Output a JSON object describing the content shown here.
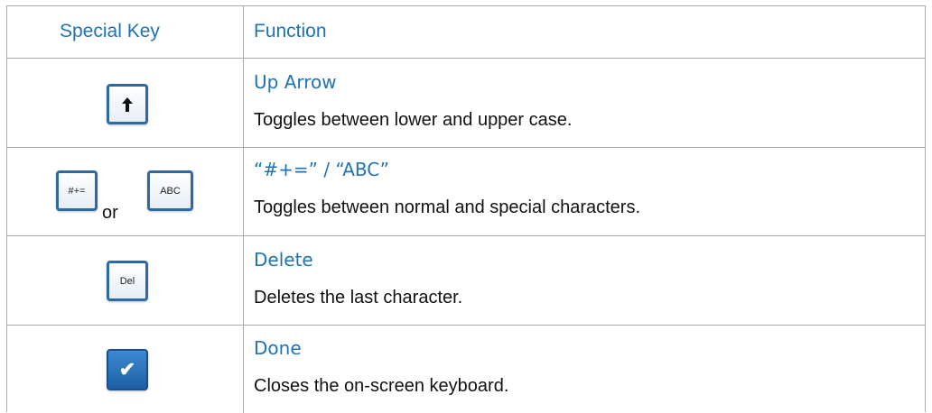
{
  "header": {
    "special_key": "Special Key",
    "function": "Function"
  },
  "rows": [
    {
      "key_icon": "up-arrow-icon",
      "title": "Up Arrow",
      "description": "Toggles between lower and upper case."
    },
    {
      "key_labels": [
        "#+=",
        "ABC"
      ],
      "or_text": "or",
      "title": "“#+=” / “ABC”",
      "description": "Toggles between normal and special characters."
    },
    {
      "key_label": "Del",
      "title": "Delete",
      "description": "Deletes the last character."
    },
    {
      "key_icon": "checkmark-icon",
      "key_glyph": "✔",
      "title": "Done",
      "description": "Closes the on-screen keyboard."
    }
  ],
  "colors": {
    "accent_text": "#1e73b4",
    "key_border": "#2d6aa3",
    "done_key": "#2a74be",
    "grid_line": "#aaaaaa"
  }
}
